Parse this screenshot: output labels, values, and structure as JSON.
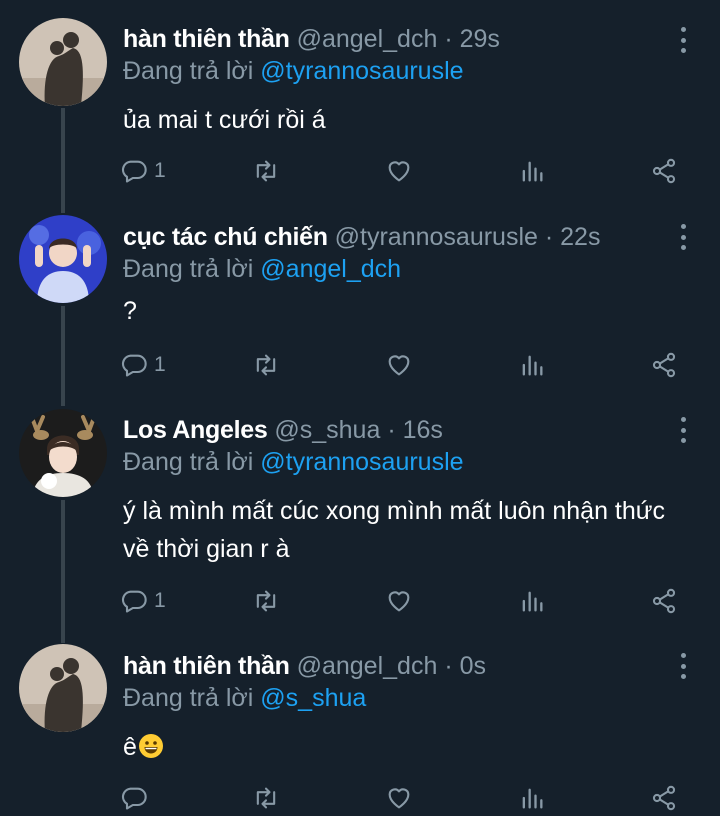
{
  "tweets": [
    {
      "name": "hàn thiên thần",
      "handle": "@angel_dch",
      "time": "29s",
      "reply_prefix": "Đang trả lời ",
      "reply_to": "@tyrannosaurusle",
      "text": "ủa mai t cưới rồi á",
      "reply_count": "1",
      "avatar": "silhouette-couple-photo"
    },
    {
      "name": "cục tác chú chiến",
      "handle": "@tyrannosaurusle",
      "time": "22s",
      "reply_prefix": "Đang trả lời ",
      "reply_to": "@angel_dch",
      "text": "?",
      "reply_count": "1",
      "avatar": "person-blue-stage-photo"
    },
    {
      "name": "Los Angeles",
      "handle": "@s_shua",
      "time": "16s",
      "reply_prefix": "Đang trả lời ",
      "reply_to": "@tyrannosaurusle",
      "text": "ý là mình mất cúc xong mình mất luôn nhận thức về thời gian r à",
      "reply_count": "1",
      "avatar": "person-antler-headband-photo"
    },
    {
      "name": "hàn thiên thần",
      "handle": "@angel_dch",
      "time": "0s",
      "reply_prefix": "Đang trả lời ",
      "reply_to": "@s_shua",
      "text": "ê",
      "emoji": "grinning-face-emoji",
      "reply_count": "",
      "avatar": "silhouette-couple-photo"
    }
  ],
  "separator": "·",
  "colors": {
    "background": "#15202b",
    "text": "#ffffff",
    "muted": "#8899a6",
    "link": "#1da1f2",
    "thread_line": "#38444d"
  }
}
